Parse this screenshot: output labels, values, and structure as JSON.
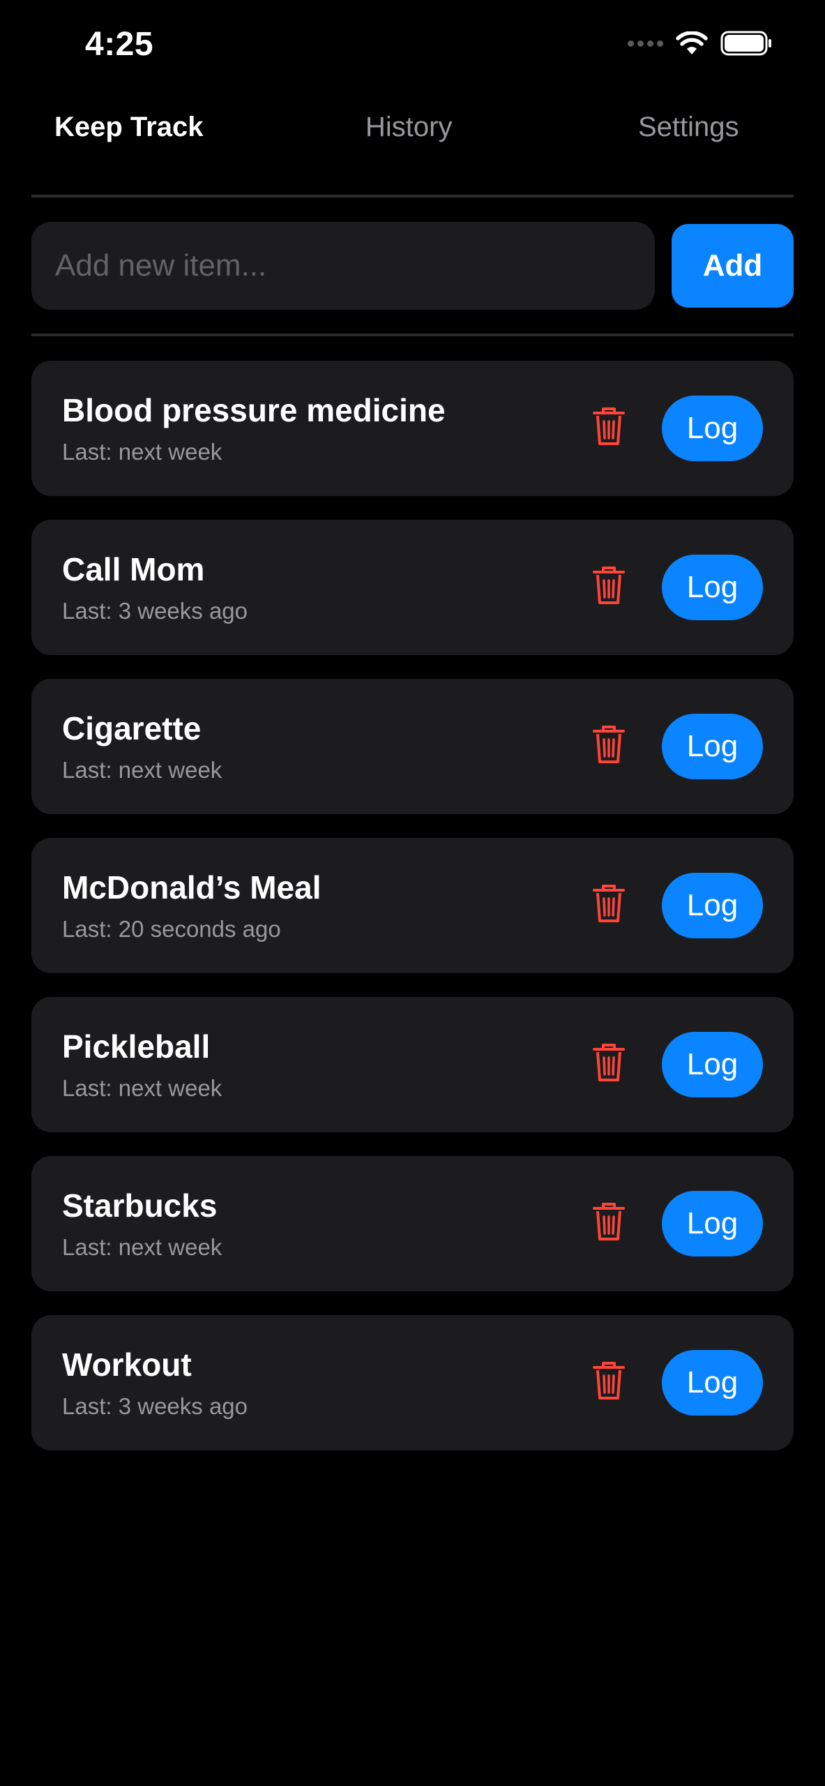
{
  "status_bar": {
    "time": "4:25",
    "icons": [
      "signal-icon",
      "wifi-icon",
      "battery-icon"
    ]
  },
  "nav": {
    "tabs": [
      {
        "label": "Keep Track",
        "active": true
      },
      {
        "label": "History",
        "active": false
      },
      {
        "label": "Settings",
        "active": false
      }
    ]
  },
  "add_item": {
    "placeholder": "Add new item...",
    "value": "",
    "button_label": "Add"
  },
  "items": [
    {
      "title": "Blood pressure medicine",
      "subtitle": "Last: next week",
      "log_label": "Log"
    },
    {
      "title": "Call Mom",
      "subtitle": "Last: 3 weeks ago",
      "log_label": "Log"
    },
    {
      "title": "Cigarette",
      "subtitle": "Last: next week",
      "log_label": "Log"
    },
    {
      "title": "McDonald’s Meal",
      "subtitle": "Last: 20 seconds ago",
      "log_label": "Log"
    },
    {
      "title": "Pickleball",
      "subtitle": "Last: next week",
      "log_label": "Log"
    },
    {
      "title": "Starbucks",
      "subtitle": "Last: next week",
      "log_label": "Log"
    },
    {
      "title": "Workout",
      "subtitle": "Last: 3 weeks ago",
      "log_label": "Log"
    }
  ],
  "colors": {
    "background": "#000000",
    "card": "#1c1c1e",
    "accent": "#0a84ff",
    "delete": "#ff453a",
    "secondary_text": "#98989d"
  }
}
